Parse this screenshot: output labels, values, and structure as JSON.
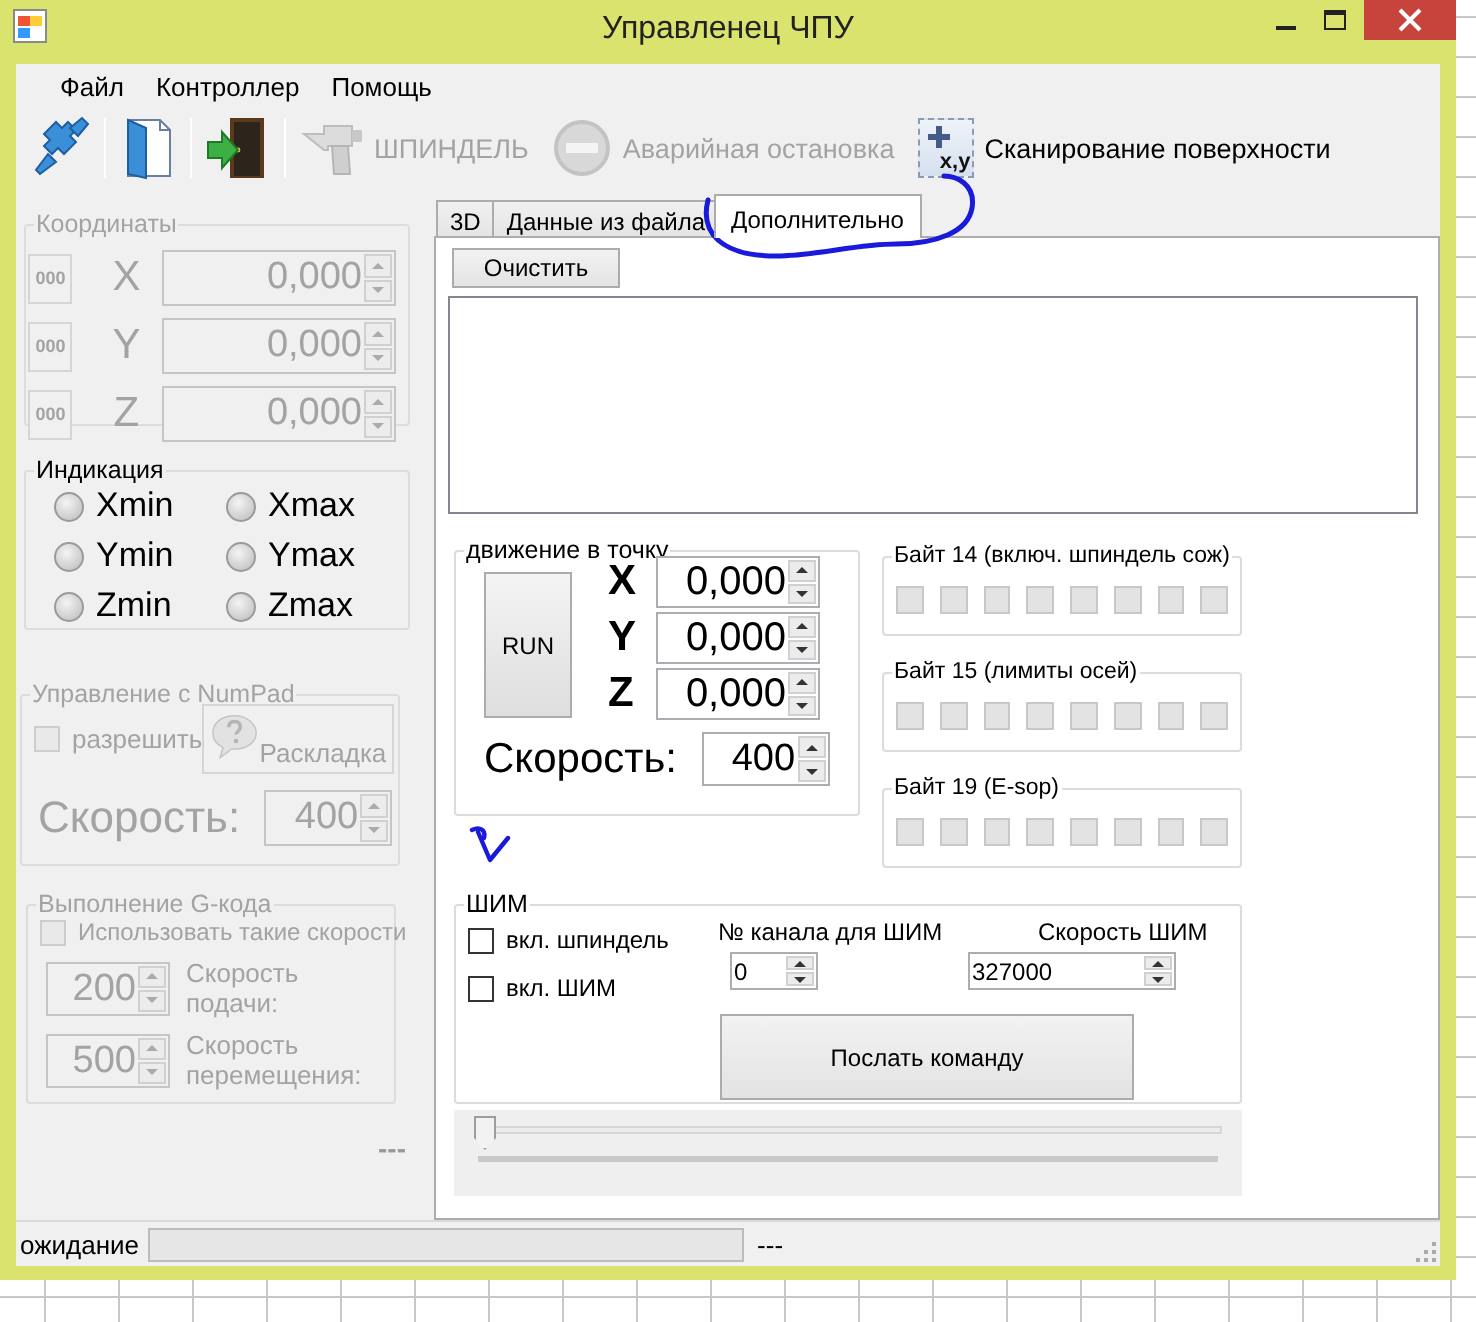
{
  "window": {
    "title": "Управленец ЧПУ"
  },
  "menu": [
    "Файл",
    "Контроллер",
    "Помощь"
  ],
  "toolbar": [
    {
      "kind": "icon",
      "disabled": false
    },
    {
      "kind": "icon",
      "disabled": false
    },
    {
      "kind": "icon",
      "disabled": false
    },
    {
      "kind": "labeled",
      "label": "ШПИНДЕЛЬ",
      "disabled": true
    },
    {
      "kind": "labeled",
      "label": "Аварийная остановка",
      "disabled": true
    },
    {
      "kind": "labeled",
      "label": "Сканирование поверхности",
      "icon_text": "x,y",
      "disabled": false
    }
  ],
  "coordinates": {
    "title": "Координаты",
    "disabled": true,
    "rows": [
      {
        "button": "000",
        "axis": "X",
        "value": "0,000"
      },
      {
        "button": "000",
        "axis": "Y",
        "value": "0,000"
      },
      {
        "button": "000",
        "axis": "Z",
        "value": "0,000"
      }
    ]
  },
  "indication": {
    "title": "Индикация",
    "leds": [
      {
        "label": "Xmin",
        "on": false
      },
      {
        "label": "Xmax",
        "on": false
      },
      {
        "label": "Ymin",
        "on": false
      },
      {
        "label": "Ymax",
        "on": false
      },
      {
        "label": "Zmin",
        "on": false
      },
      {
        "label": "Zmax",
        "on": false
      }
    ]
  },
  "numpad": {
    "title": "Управление с NumPad",
    "disabled": true,
    "checkbox": {
      "label": "разрешить",
      "checked": false
    },
    "layout_button": "Раскладка",
    "speed_label": "Скорость:",
    "speed": "400"
  },
  "gcode": {
    "title": "Выполнение G-кода",
    "disabled": true,
    "checkbox": {
      "label": "Использовать такие скорости",
      "checked": false
    },
    "fields": [
      {
        "value": "200",
        "label": "Скорость подачи:"
      },
      {
        "value": "500",
        "label": "Скорость перемещения:"
      }
    ]
  },
  "left_status": "---",
  "tabs": [
    {
      "label": "3D",
      "selected": false
    },
    {
      "label": "Данные из файла",
      "selected": false
    },
    {
      "label": "Дополнительно",
      "selected": true
    }
  ],
  "extra": {
    "clear_button": "Очистить",
    "move": {
      "title": "движение в точку",
      "run_button": "RUN",
      "axes": [
        {
          "axis": "X",
          "value": "0,000"
        },
        {
          "axis": "Y",
          "value": "0,000"
        },
        {
          "axis": "Z",
          "value": "0,000"
        }
      ],
      "speed_label": "Скорость:",
      "speed": "400"
    },
    "bytes": [
      {
        "title": "Байт 14 (включ. шпиндель сож)",
        "bits": [
          {
            "on": false
          },
          {
            "on": false
          },
          {
            "on": false
          },
          {
            "on": false
          },
          {
            "on": false
          },
          {
            "on": false
          },
          {
            "on": false
          },
          {
            "on": false
          }
        ]
      },
      {
        "title": "Байт 15 (лимиты осей)",
        "bits": [
          {
            "on": false
          },
          {
            "on": false
          },
          {
            "on": false
          },
          {
            "on": false
          },
          {
            "on": false
          },
          {
            "on": false
          },
          {
            "on": false
          },
          {
            "on": false
          }
        ]
      },
      {
        "title": "Байт 19 (E-sop)",
        "bits": [
          {
            "on": false
          },
          {
            "on": false
          },
          {
            "on": false
          },
          {
            "on": false
          },
          {
            "on": false
          },
          {
            "on": false
          },
          {
            "on": false
          },
          {
            "on": false
          }
        ]
      }
    ],
    "pwm": {
      "title": "ШИМ",
      "checkboxes": [
        {
          "label": "вкл. шпиндель",
          "checked": false
        },
        {
          "label": "вкл. ШИМ",
          "checked": false
        }
      ],
      "channel_label": "№ канала для ШИМ",
      "channel": "0",
      "speed_label": "Скорость ШИМ",
      "speed": "327000",
      "send_button": "Послать команду"
    },
    "slider": {
      "level": 0
    }
  },
  "status_bar": {
    "text": "ожидание",
    "progress": {
      "level": 0
    },
    "status": "---"
  }
}
